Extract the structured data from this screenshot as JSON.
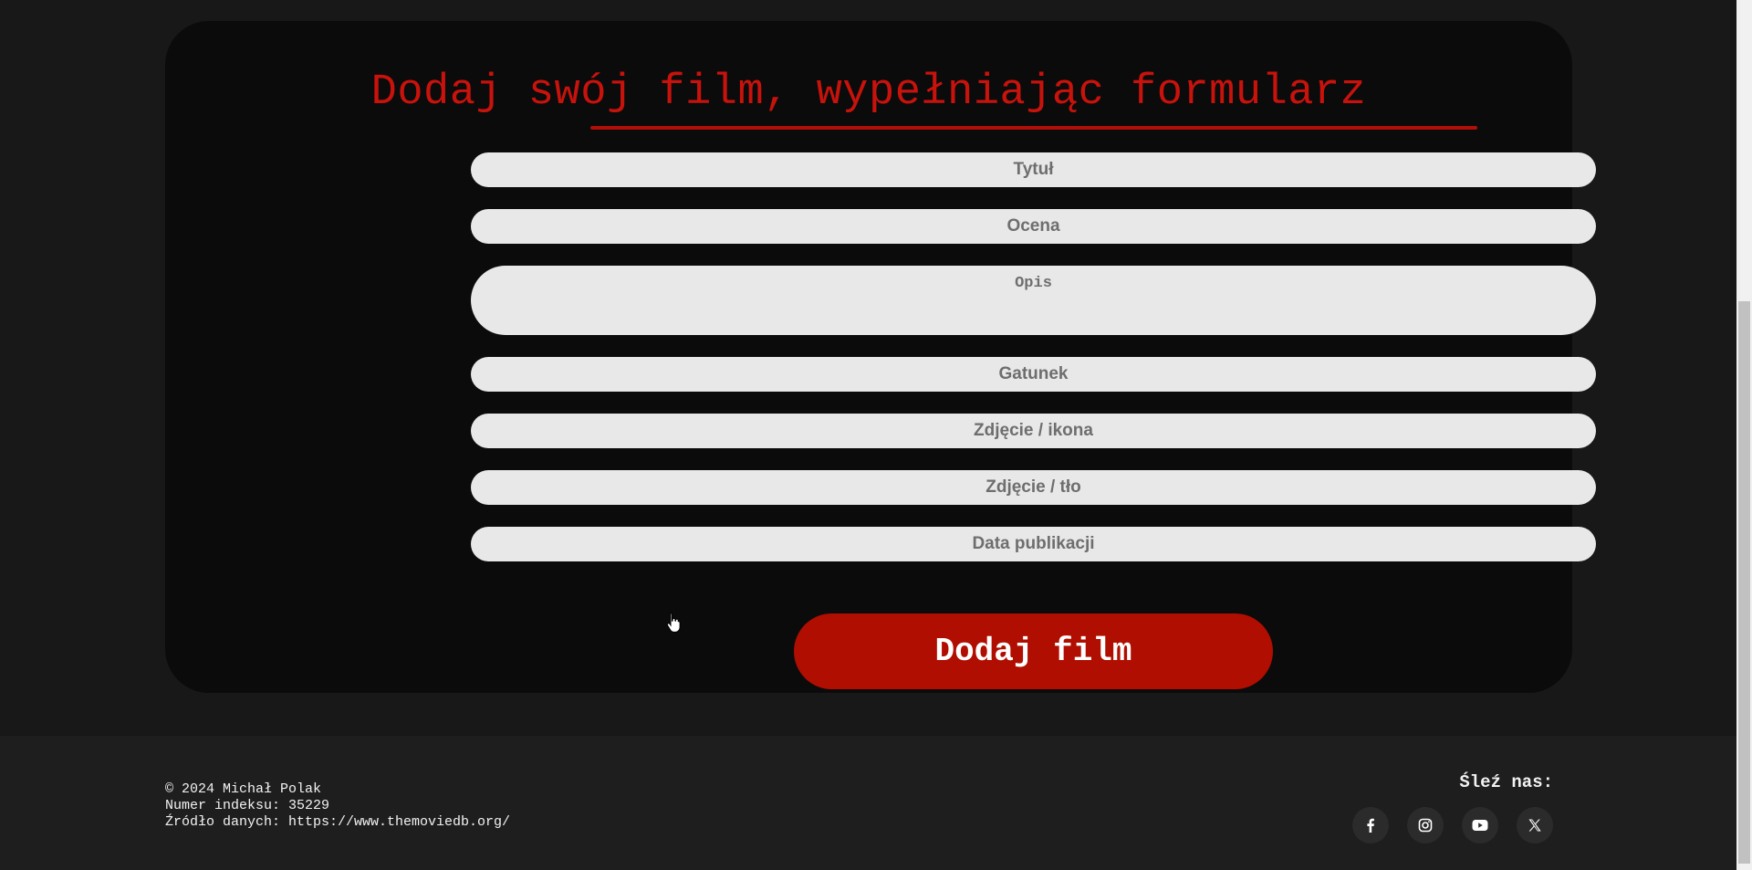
{
  "form": {
    "title": "Dodaj swój film, wypełniając formularz",
    "fields": {
      "title_placeholder": "Tytuł",
      "rating_placeholder": "Ocena",
      "description_placeholder": "Opis",
      "genre_placeholder": "Gatunek",
      "icon_image_placeholder": "Zdjęcie / ikona",
      "background_image_placeholder": "Zdjęcie / tło",
      "release_date_placeholder": "Data publikacji"
    },
    "submit_label": "Dodaj film"
  },
  "footer": {
    "copyright": "© 2024 Michał Polak",
    "student_id": "Numer indeksu: 35229",
    "data_source": "Źródło danych: https://www.themoviedb.org/",
    "follow_label": "Śleź nas:",
    "social": [
      "facebook-icon",
      "instagram-icon",
      "youtube-icon",
      "x-icon"
    ]
  },
  "colors": {
    "accent": "#b00e00",
    "title": "#c8120c",
    "card_background": "#0b0b0b",
    "page_background": "#181818",
    "field_background": "#e8e8e8"
  }
}
